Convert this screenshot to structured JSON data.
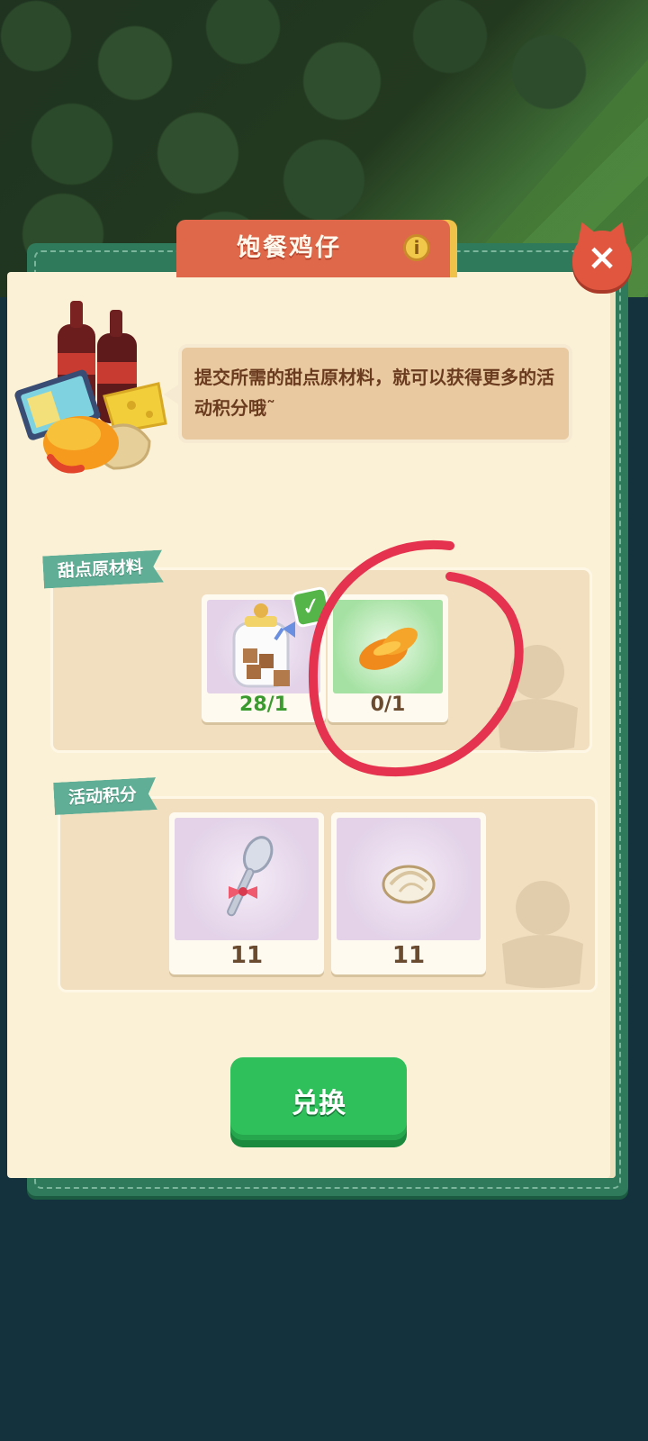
{
  "dialog": {
    "title": "饱餐鸡仔",
    "info_icon": "i",
    "close_icon": "×"
  },
  "speech": {
    "text": "提交所需的甜点原材料，就可以获得更多的活动积分哦˜"
  },
  "materials": {
    "label": "甜点原材料",
    "items": [
      {
        "name": "sugar-cube-jar",
        "count": "28/1",
        "satisfied": true
      },
      {
        "name": "mango-slices",
        "count": "0/1",
        "satisfied": false
      }
    ]
  },
  "points": {
    "label": "活动积分",
    "items": [
      {
        "name": "decorated-spoon",
        "count": "11"
      },
      {
        "name": "cream-swirl",
        "count": "11"
      }
    ]
  },
  "actions": {
    "redeem_label": "兑换"
  },
  "colors": {
    "accent_green": "#2fbf5b",
    "ribbon_orange": "#e0684a",
    "teal_label": "#5fae95",
    "annotation_red": "#e4324f"
  }
}
